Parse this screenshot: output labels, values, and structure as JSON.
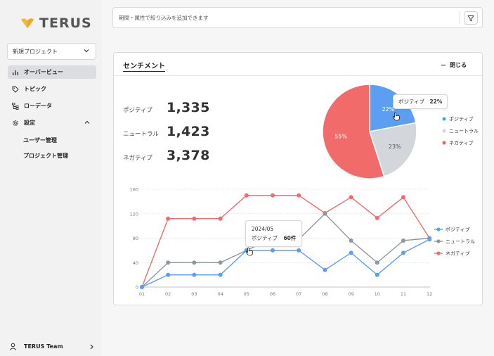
{
  "app": {
    "brand": "TERUS",
    "brand_color": "#f6b83a"
  },
  "sidebar": {
    "project_select": "新規プロジェクト",
    "items": [
      {
        "label": "オーバービュー",
        "icon": "bar-chart-icon",
        "active": true
      },
      {
        "label": "トピック",
        "icon": "tag-icon"
      },
      {
        "label": "ローデータ",
        "icon": "tree-icon"
      },
      {
        "label": "設定",
        "icon": "gear-icon"
      }
    ],
    "sub_items": [
      "ユーザー管理",
      "プロジェクト管理"
    ],
    "user": "TERUS Team"
  },
  "filter": {
    "placeholder": "期間・属性で絞り込みを追加できます"
  },
  "card": {
    "title": "センチメント",
    "close_label": "閉じる",
    "stats": [
      {
        "label": "ポジティブ",
        "value": "1,335"
      },
      {
        "label": "ニュートラル",
        "value": "1,423"
      },
      {
        "label": "ネガティブ",
        "value": "3,378"
      }
    ]
  },
  "chart_data": [
    {
      "type": "pie",
      "slices": [
        {
          "name": "ポジティブ",
          "value": 22,
          "label": "22%",
          "color": "#5b9ef2"
        },
        {
          "name": "ニュートラル",
          "value": 23,
          "label": "23%",
          "color": "#d3d6da"
        },
        {
          "name": "ネガティブ",
          "value": 55,
          "label": "55%",
          "color": "#f26b6b"
        }
      ],
      "legend": [
        "ポジティブ",
        "ニュートラル",
        "ネガティブ"
      ],
      "legend_colors": [
        "#2cb7b0",
        "#d3d6da",
        "#f25f5f"
      ],
      "legend_position": "right",
      "tooltip": {
        "name": "ポジティブ",
        "value": "22%"
      }
    },
    {
      "type": "line",
      "x": [
        "01",
        "02",
        "03",
        "04",
        "05",
        "06",
        "07",
        "08",
        "09",
        "10",
        "11",
        "12"
      ],
      "series": [
        {
          "name": "ポジティブ",
          "color": "#5b9ef2",
          "values": [
            0,
            20,
            20,
            20,
            60,
            60,
            60,
            28,
            56,
            20,
            56,
            78
          ]
        },
        {
          "name": "ニュートラル",
          "color": "#8c9aa0",
          "values": [
            0,
            40,
            40,
            40,
            60,
            80,
            78,
            120,
            76,
            40,
            76,
            80
          ]
        },
        {
          "name": "ネガティブ",
          "color": "#f26b6b",
          "values": [
            0,
            112,
            112,
            112,
            150,
            150,
            150,
            121,
            147,
            113,
            147,
            80
          ]
        }
      ],
      "yticks": [
        "0",
        "40",
        "80",
        "120",
        "160"
      ],
      "ylim": [
        0,
        160
      ],
      "grid": true,
      "legend_position": "right",
      "tooltip": {
        "title": "2024/05",
        "name": "ポジティブ",
        "value": "60件"
      }
    }
  ]
}
